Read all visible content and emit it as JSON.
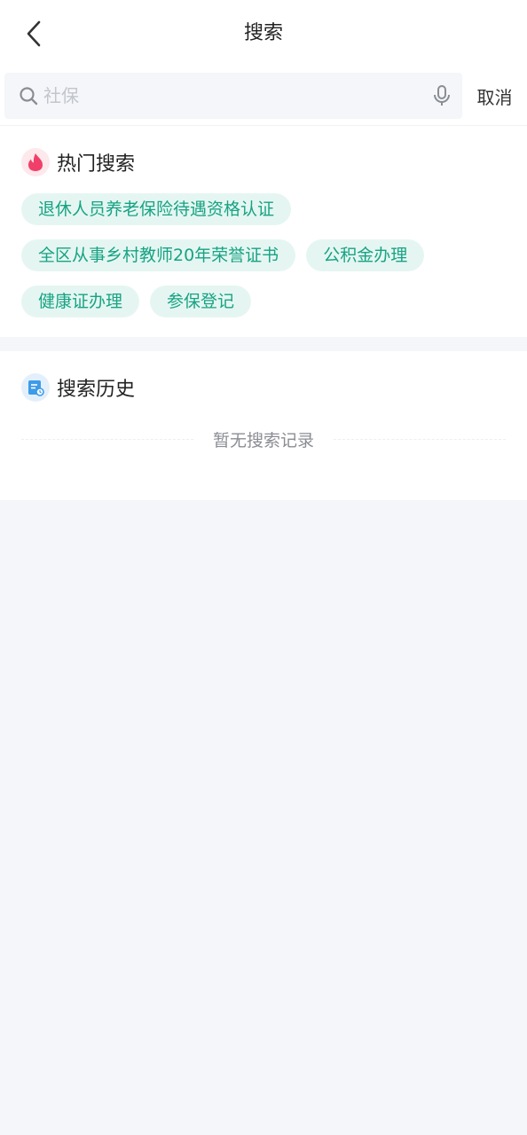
{
  "header": {
    "title": "搜索",
    "back_icon": "chevron-left-icon"
  },
  "search": {
    "placeholder": "社保",
    "value": "",
    "search_icon": "search-icon",
    "mic_icon": "microphone-icon",
    "cancel_label": "取消"
  },
  "hot_search": {
    "title": "热门搜索",
    "icon": "flame-icon",
    "icon_color": "#f0406a",
    "tags": [
      "退休人员养老保险待遇资格认证",
      "全区从事乡村教师20年荣誉证书",
      "公积金办理",
      "健康证办理",
      "参保登记"
    ]
  },
  "history": {
    "title": "搜索历史",
    "icon": "document-clock-icon",
    "icon_color": "#3d9be9",
    "empty_text": "暂无搜索记录"
  },
  "colors": {
    "accent": "#17a383",
    "tag_bg": "#e5f6f2",
    "page_bg": "#f4f6f9"
  }
}
